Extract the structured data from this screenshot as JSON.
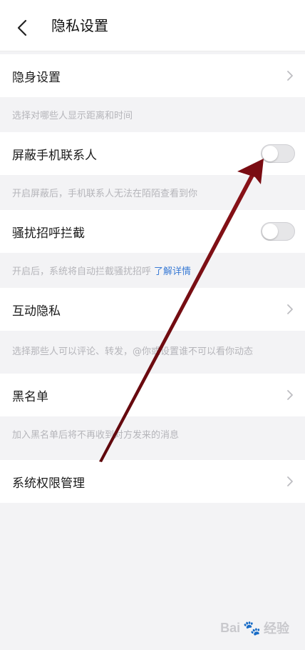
{
  "header": {
    "title": "隐私设置"
  },
  "items": {
    "invisible": {
      "label": "隐身设置",
      "hint": "选择对哪些人显示距离和时间"
    },
    "block_contacts": {
      "label": "屏蔽手机联系人",
      "hint": "开启屏蔽后，手机联系人无法在陌陌查看到你",
      "toggle_on": false
    },
    "harass_block": {
      "label": "骚扰招呼拦截",
      "hint": "开启后，系统将自动拦截骚扰招呼",
      "hint_link": "了解详情",
      "toggle_on": false
    },
    "interaction": {
      "label": "互动隐私",
      "hint": "选择那些人可以评论、转发，@你或设置谁不可以看你动态"
    },
    "blacklist": {
      "label": "黑名单",
      "hint": "加入黑名单后将不再收到对方发来的消息"
    },
    "system_perm": {
      "label": "系统权限管理"
    }
  },
  "watermark": {
    "text": "Bai",
    "text2": "经验"
  },
  "colors": {
    "link": "#3a7bd5",
    "arrow": "#7a0c12"
  },
  "icons": {
    "back": "back-arrow-icon",
    "chevron": "chevron-right-icon",
    "paw": "baidu-paw-icon"
  }
}
